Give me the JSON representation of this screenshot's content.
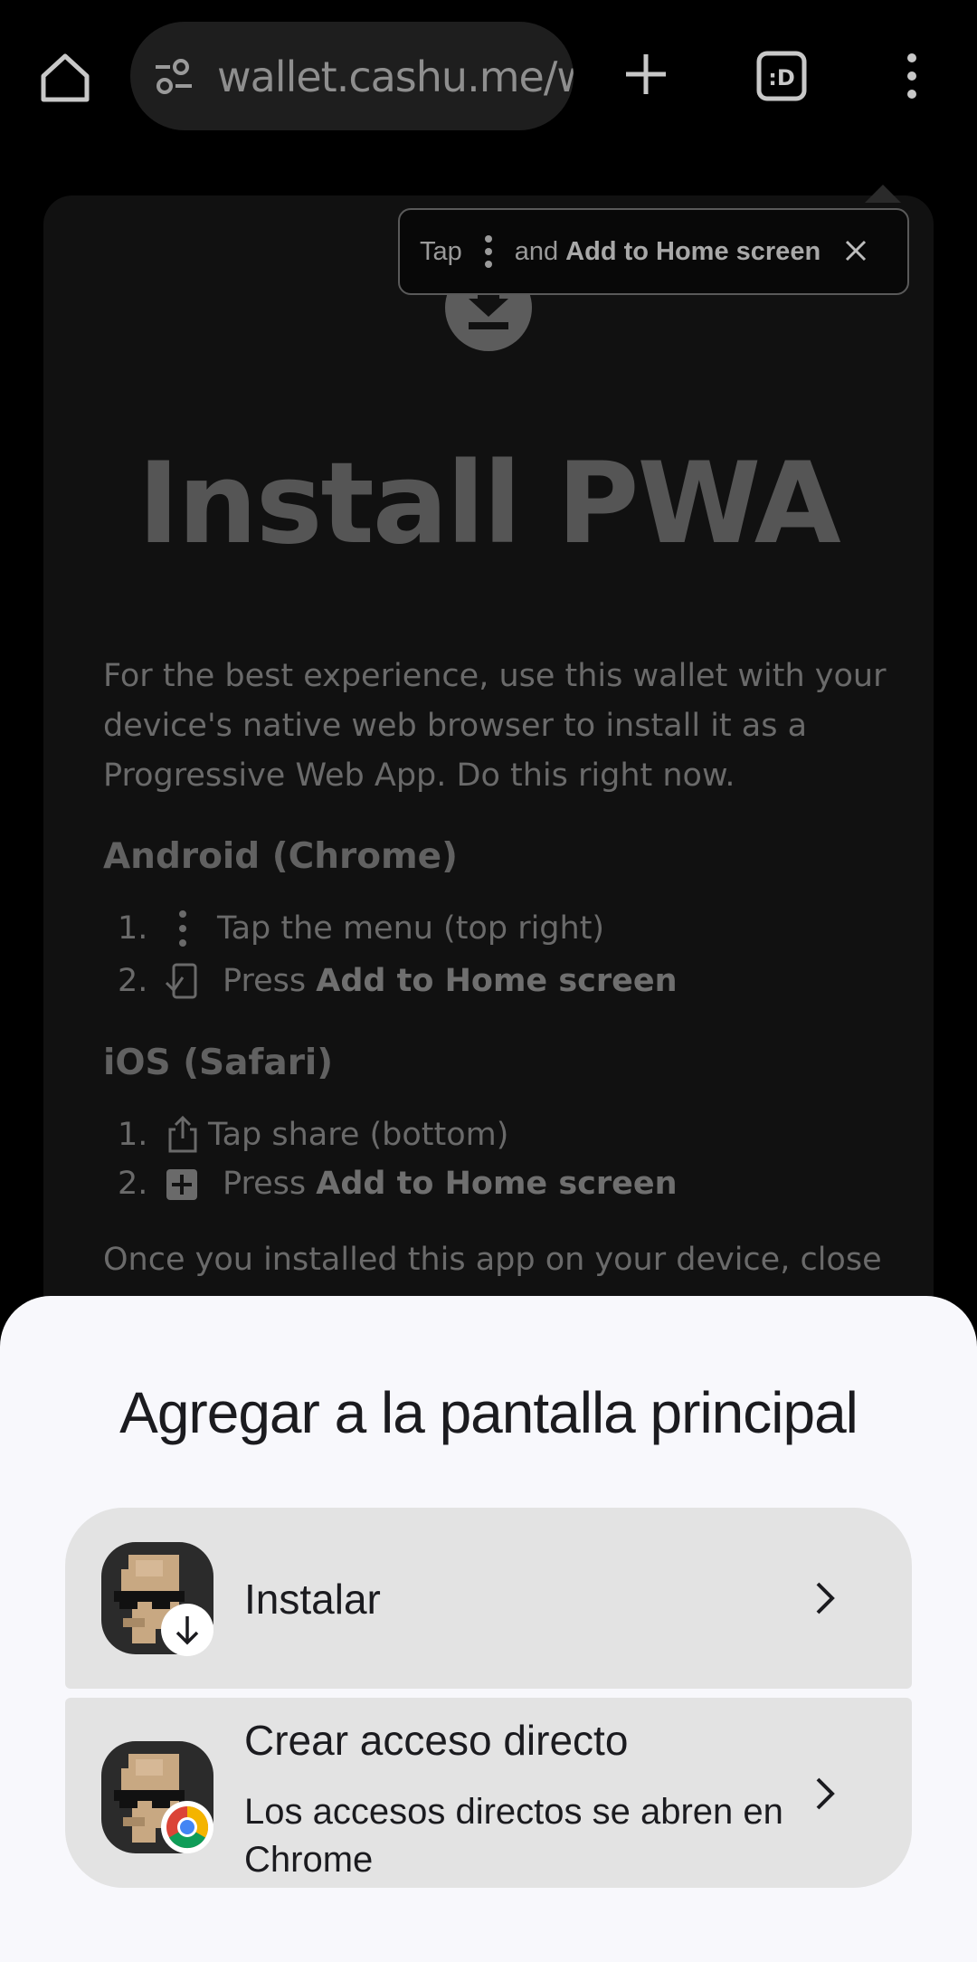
{
  "browser": {
    "url": "wallet.cashu.me/w"
  },
  "tooltip": {
    "prefix": "Tap",
    "middle": "and",
    "action": "Add to Home screen"
  },
  "page": {
    "title": "Install PWA",
    "intro": "For the best experience, use this wallet with your device's native web browser to install it as a Progressive Web App. Do this right now.",
    "android": {
      "heading": "Android (Chrome)",
      "step1_num": "1.",
      "step1_text": "Tap the menu (top right)",
      "step2_num": "2.",
      "step2_text": "Press ",
      "step2_bold": "Add to Home screen"
    },
    "ios": {
      "heading": "iOS (Safari)",
      "step1_num": "1.",
      "step1_text": "Tap share (bottom)",
      "step2_num": "2.",
      "step2_text": "Press ",
      "step2_bold": "Add to Home screen"
    },
    "outro": "Once you installed this app on your device, close"
  },
  "sheet": {
    "title": "Agregar a la pantalla principal",
    "install_label": "Instalar",
    "shortcut_label": "Crear acceso directo",
    "shortcut_sub": "Los accesos directos se abren en Chrome"
  }
}
